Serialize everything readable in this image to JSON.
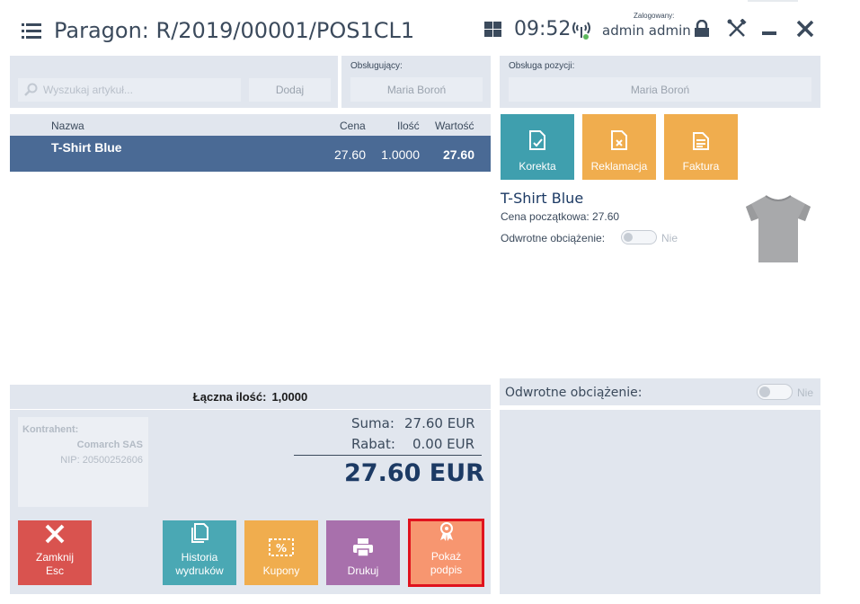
{
  "header": {
    "title": "Paragon: R/2019/00001/POS1CL1",
    "time": "09:52",
    "logged_label": "Zalogowany:",
    "user": "admin admin"
  },
  "search": {
    "placeholder": "Wyszukaj artykuł...",
    "add_label": "Dodaj"
  },
  "serving": {
    "label": "Obsługujący:",
    "value": "Maria Boroń"
  },
  "position_service": {
    "label": "Obsługa pozycji:",
    "value": "Maria Boroń"
  },
  "table": {
    "headers": [
      "Nazwa",
      "Cena",
      "Ilość",
      "Wartość"
    ],
    "rows": [
      {
        "name": "T-Shirt Blue",
        "price": "27.60",
        "qty": "1.0000",
        "value": "27.60"
      }
    ]
  },
  "totals": {
    "qty_label": "Łączna ilość:",
    "qty_value": "1,0000",
    "sum_label": "Suma:",
    "sum_value": "27.60 EUR",
    "discount_label": "Rabat:",
    "discount_value": "0.00 EUR",
    "grand_total": "27.60 EUR"
  },
  "contractor": {
    "label": "Kontrahent:",
    "name": "Comarch SAS",
    "nip": "NIP: 20500252606"
  },
  "actions": {
    "close": [
      "Zamknij",
      "Esc"
    ],
    "history": [
      "Historia",
      "wydruków"
    ],
    "coupons": "Kupony",
    "print": "Drukuj",
    "signature": [
      "Pokaż",
      "podpis"
    ]
  },
  "right_actions": {
    "korekta": "Korekta",
    "reklamacja": "Reklamacja",
    "faktura": "Faktura"
  },
  "item_details": {
    "title": "T-Shirt Blue",
    "initial_price": "Cena początkowa: 27.60",
    "reverse_charge_label": "Odwrotne obciążenie:",
    "reverse_charge_value": "Nie"
  },
  "reverse_charge_bar": {
    "label": "Odwrotne obciążenie:",
    "value": "Nie"
  },
  "colors": {
    "selected_row": "#4a6a95",
    "close": "#d9534f",
    "teal": "#4aa8b4",
    "orange": "#f0ad4e",
    "purple": "#a870ac",
    "signature": "#f79670",
    "highlight": "#e0131e"
  }
}
